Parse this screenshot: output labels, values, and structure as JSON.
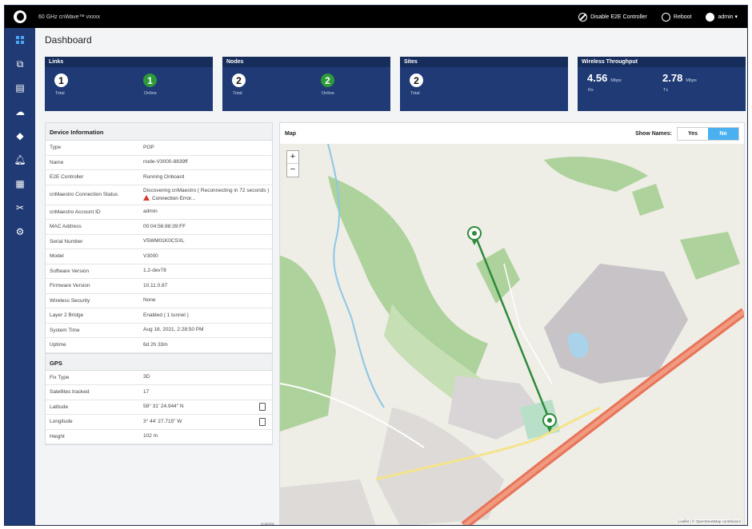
{
  "topbar": {
    "product": "60 GHz cnWave™ vxxxx",
    "disable_e2e": "Disable E2E Controller",
    "reboot": "Reboot",
    "user": "admin ▾"
  },
  "page_title": "Dashboard",
  "cards": {
    "links": {
      "title": "Links",
      "total": "1",
      "total_label": "Total",
      "online": "1",
      "online_label": "Online"
    },
    "nodes": {
      "title": "Nodes",
      "total": "2",
      "total_label": "Total",
      "online": "2",
      "online_label": "Online"
    },
    "sites": {
      "title": "Sites",
      "total": "2",
      "total_label": "Total"
    },
    "throughput": {
      "title": "Wireless Throughput",
      "rx": "4.56",
      "rx_unit": "Mbps",
      "rx_label": "Rx",
      "tx": "2.78",
      "tx_unit": "Mbps",
      "tx_label": "Tx"
    }
  },
  "device_info": {
    "title": "Device Information",
    "rows": [
      {
        "k": "Type",
        "v": "POP"
      },
      {
        "k": "Name",
        "v": "node-V3000-8839ff"
      },
      {
        "k": "E2E Controller",
        "v": "Running Onboard"
      },
      {
        "k": "cnMaestro Connection Status",
        "v": "Discovering cnMaestro ( Reconnecting in 72 seconds )",
        "err": "Connection Error..."
      },
      {
        "k": "cnMaestro Account ID",
        "v": "admin"
      },
      {
        "k": "MAC Address",
        "v": "00:04:56:88:39:FF"
      },
      {
        "k": "Serial Number",
        "v": "V5WM01K0CSXL"
      },
      {
        "k": "Model",
        "v": "V3000"
      },
      {
        "k": "Software Version",
        "v": "1.2-dev78"
      },
      {
        "k": "Firmware Version",
        "v": "10.11.0.87"
      },
      {
        "k": "Wireless Security",
        "v": "None"
      },
      {
        "k": "Layer 2 Bridge",
        "v": "Enabled ( 1 tunnel )"
      },
      {
        "k": "System Time",
        "v": "Aug 18, 2021, 2:28:50 PM"
      },
      {
        "k": "Uptime",
        "v": "6d 2h 33m"
      }
    ]
  },
  "gps": {
    "title": "GPS",
    "rows": [
      {
        "k": "Fix Type",
        "v": "3D"
      },
      {
        "k": "Satellites tracked",
        "v": "17"
      },
      {
        "k": "Latitude",
        "v": "58° 31' 24.944\" N"
      },
      {
        "k": "Longitude",
        "v": "3° 44' 27.715\" W"
      },
      {
        "k": "Height",
        "v": "102 m"
      }
    ]
  },
  "map": {
    "title": "Map",
    "show_names_label": "Show Names:",
    "yes": "Yes",
    "no": "No",
    "zoom_in": "+",
    "zoom_out": "−",
    "attribution": "Leaflet | © OpenStreetMap contributors",
    "copy_label": "Copying"
  },
  "colors": {
    "navy": "#1f3a75",
    "online": "#2d9b3a",
    "accent": "#4ab0ef"
  }
}
